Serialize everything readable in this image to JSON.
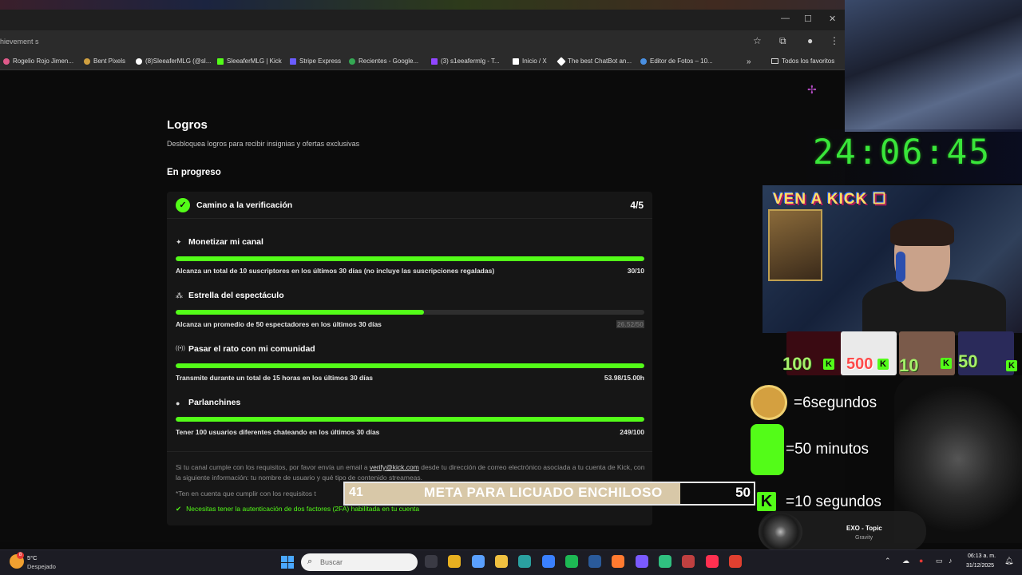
{
  "browser": {
    "address_text": "hievement s",
    "bookmarks": [
      {
        "label": "Rogelio Rojo Jimen...",
        "color": "#e05a8a"
      },
      {
        "label": "Bent Pixels",
        "color": "#d0a040"
      },
      {
        "label": "(8)SleeaferMLG (@sl...",
        "color": "#ffffff"
      },
      {
        "label": "SleeaferMLG | Kick",
        "color": "#53fc18"
      },
      {
        "label": "Stripe Express",
        "color": "#6a5cff"
      },
      {
        "label": "Recientes - Google...",
        "color": "#34a853"
      },
      {
        "label": "(3) s1eeafermlg - T...",
        "color": "#9146ff"
      },
      {
        "label": "Inicio / X",
        "color": "#ffffff"
      },
      {
        "label": "The best ChatBot an...",
        "color": "#ffffff"
      },
      {
        "label": "Editor de Fotos – 10...",
        "color": "#4a90e2"
      },
      {
        "label": "Todos los favoritos",
        "color": "#cfcfcf"
      }
    ]
  },
  "page": {
    "title": "Logros",
    "subtitle": "Desbloquea logros para recibir insignias y ofertas exclusivas",
    "section": "En progreso",
    "card": {
      "title": "Camino a la verificación",
      "count": "4/5",
      "requirements": [
        {
          "icon": "✦",
          "title": "Monetizar mi canal",
          "progress": 1.0,
          "desc": "Alcanza un total de 10 suscriptores en los últimos 30 días (no incluye las suscripciones regaladas)",
          "value": "30/10"
        },
        {
          "icon": "⁂",
          "title": "Estrella del espectáculo",
          "progress": 0.53,
          "desc": "Alcanza un promedio de 50 espectadores en los últimos 30 días",
          "value": "26.52/50"
        },
        {
          "icon": "((•))",
          "title": "Pasar el rato con mi comunidad",
          "progress": 1.0,
          "desc": "Transmite durante un total de 15 horas en los últimos 30 días",
          "value": "53.98/15.00h"
        },
        {
          "icon": "●",
          "title": "Parlanchines",
          "progress": 1.0,
          "desc": "Tener 100 usuarios diferentes chateando en los últimos 30 días",
          "value": "249/100"
        }
      ],
      "note1_a": "Si tu canal cumple con los requisitos, por favor envía un email a ",
      "note1_mail": "verify@kick.com",
      "note1_b": " desde tu dirección de correo electrónico asociada a tu cuenta de Kick, con la siguiente información: tu nombre de usuario y qué tipo de contenido streameas.",
      "note2": "*Ten en cuenta que cumplir con los requisitos t",
      "twofa": "Necesitas tener la autenticación de dos factores (2FA) habilitada en tu cuenta"
    }
  },
  "overlay": {
    "timer": "24:06:45",
    "webcam_title": "VEN A KICK",
    "tiles": [
      "100",
      "500",
      "10",
      "50"
    ],
    "rules": [
      "=6segundos",
      "=50 minutos",
      "=10 segundos"
    ],
    "goal": {
      "left": "41",
      "label": "META PARA LICUADO ENCHILOSO",
      "right": "50",
      "progress": 0.82
    },
    "music": {
      "title": "EXO - Topic",
      "artist": "Gravity"
    }
  },
  "taskbar": {
    "weather_temp": "5°C",
    "weather_desc": "Despejado",
    "weather_badge": "8",
    "search_placeholder": "Buscar",
    "time": "06:13 a. m.",
    "date": "31/12/2025",
    "apps": [
      "#3a3a44",
      "#e8b020",
      "#5aa0ff",
      "#f0c040",
      "#2aa0a0",
      "#3a80ff",
      "#1db954",
      "#2a5a9a",
      "#ff7a30",
      "#7a5aff",
      "#30c080",
      "#c04040",
      "#ff3050",
      "#e04030"
    ]
  }
}
